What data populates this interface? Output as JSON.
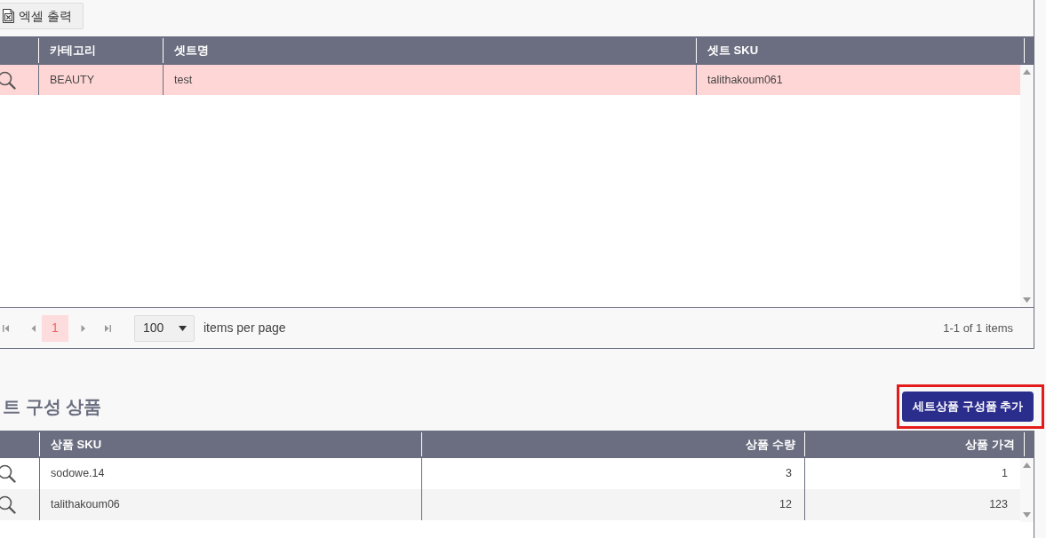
{
  "export_button": {
    "label": "엑셀 출력"
  },
  "set_table": {
    "columns": [
      {
        "label": "카테고리",
        "kind": "text"
      },
      {
        "label": "셋트명",
        "kind": "text"
      },
      {
        "label": "셋트 SKU",
        "kind": "text"
      }
    ],
    "rows": [
      {
        "selected": true,
        "cells": [
          "BEAUTY",
          "test",
          "talithakoum061"
        ]
      }
    ]
  },
  "pager": {
    "pages": [
      {
        "label": "1",
        "selected": true
      }
    ],
    "page_size": "100",
    "page_size_label": "items per page",
    "summary": "1-1 of 1 items"
  },
  "components_section": {
    "title": "트 구성 상품",
    "add_button": {
      "label": "세트상품 구성품 추가",
      "highlighted": true
    }
  },
  "component_table": {
    "columns": [
      {
        "label": "상품 SKU",
        "kind": "text"
      },
      {
        "label": "상품 수량",
        "kind": "number"
      },
      {
        "label": "상품 가격",
        "kind": "number"
      }
    ],
    "rows": [
      {
        "selected": false,
        "cells": [
          "sodowe.14",
          "3",
          "1"
        ]
      },
      {
        "selected": false,
        "cells": [
          "talithakoum06",
          "12",
          "123"
        ]
      }
    ]
  }
}
